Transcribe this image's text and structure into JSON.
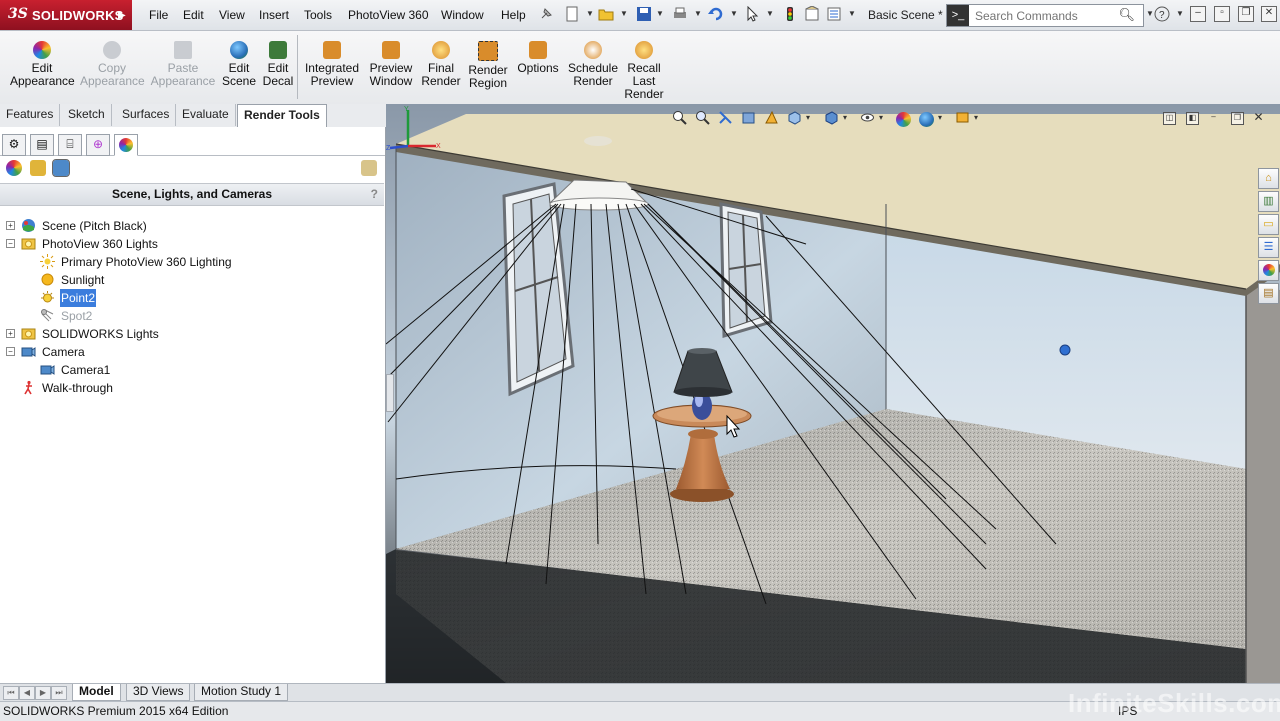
{
  "app": {
    "logo_ds": "3S",
    "logo_name": "SOLIDWORKS"
  },
  "menu": [
    "File",
    "Edit",
    "View",
    "Insert",
    "Tools",
    "PhotoView 360",
    "Window",
    "Help"
  ],
  "scene_dropdown": "Basic Scene *",
  "search": {
    "placeholder": "Search Commands"
  },
  "toolbar": {
    "edit_appearance": "Edit Appearance",
    "copy_appearance": "Copy Appearance",
    "paste_appearance": "Paste Appearance",
    "edit_scene": "Edit Scene",
    "edit_decal": "Edit Decal",
    "integrated_preview": "Integrated Preview",
    "preview_window": "Preview Window",
    "final_render": "Final Render",
    "render_region": "Render Region",
    "options": "Options",
    "schedule_render": "Schedule Render",
    "recall_last_render": "Recall Last Render"
  },
  "command_tabs": [
    "Features",
    "Sketch",
    "Surfaces",
    "Evaluate",
    "Render Tools"
  ],
  "panel": {
    "title": "Scene, Lights, and Cameras",
    "help": "?"
  },
  "tree": [
    {
      "label": "Scene (Pitch Black)",
      "icon": "scene-icon"
    },
    {
      "label": "PhotoView 360 Lights",
      "icon": "lights-folder-icon"
    },
    {
      "label": "Primary PhotoView 360 Lighting",
      "icon": "primary-light-icon"
    },
    {
      "label": "Sunlight",
      "icon": "sun-icon"
    },
    {
      "label": "Point2",
      "icon": "point-light-icon"
    },
    {
      "label": "Spot2",
      "icon": "spot-light-icon"
    },
    {
      "label": "SOLIDWORKS Lights",
      "icon": "lights-folder-icon"
    },
    {
      "label": "Camera",
      "icon": "camera-folder-icon"
    },
    {
      "label": "Camera1",
      "icon": "camera-icon"
    },
    {
      "label": "Walk-through",
      "icon": "walk-through-icon"
    }
  ],
  "bottom_tabs": [
    "Model",
    "3D Views",
    "Motion Study 1"
  ],
  "status": {
    "edition": "SOLIDWORKS Premium 2015 x64 Edition",
    "units": "IPS"
  },
  "watermark": "InfiniteSkills.com",
  "colors": {
    "brand": "#b5192a",
    "selection": "#3b7ddd",
    "ceiling": "#e6ddbd"
  }
}
